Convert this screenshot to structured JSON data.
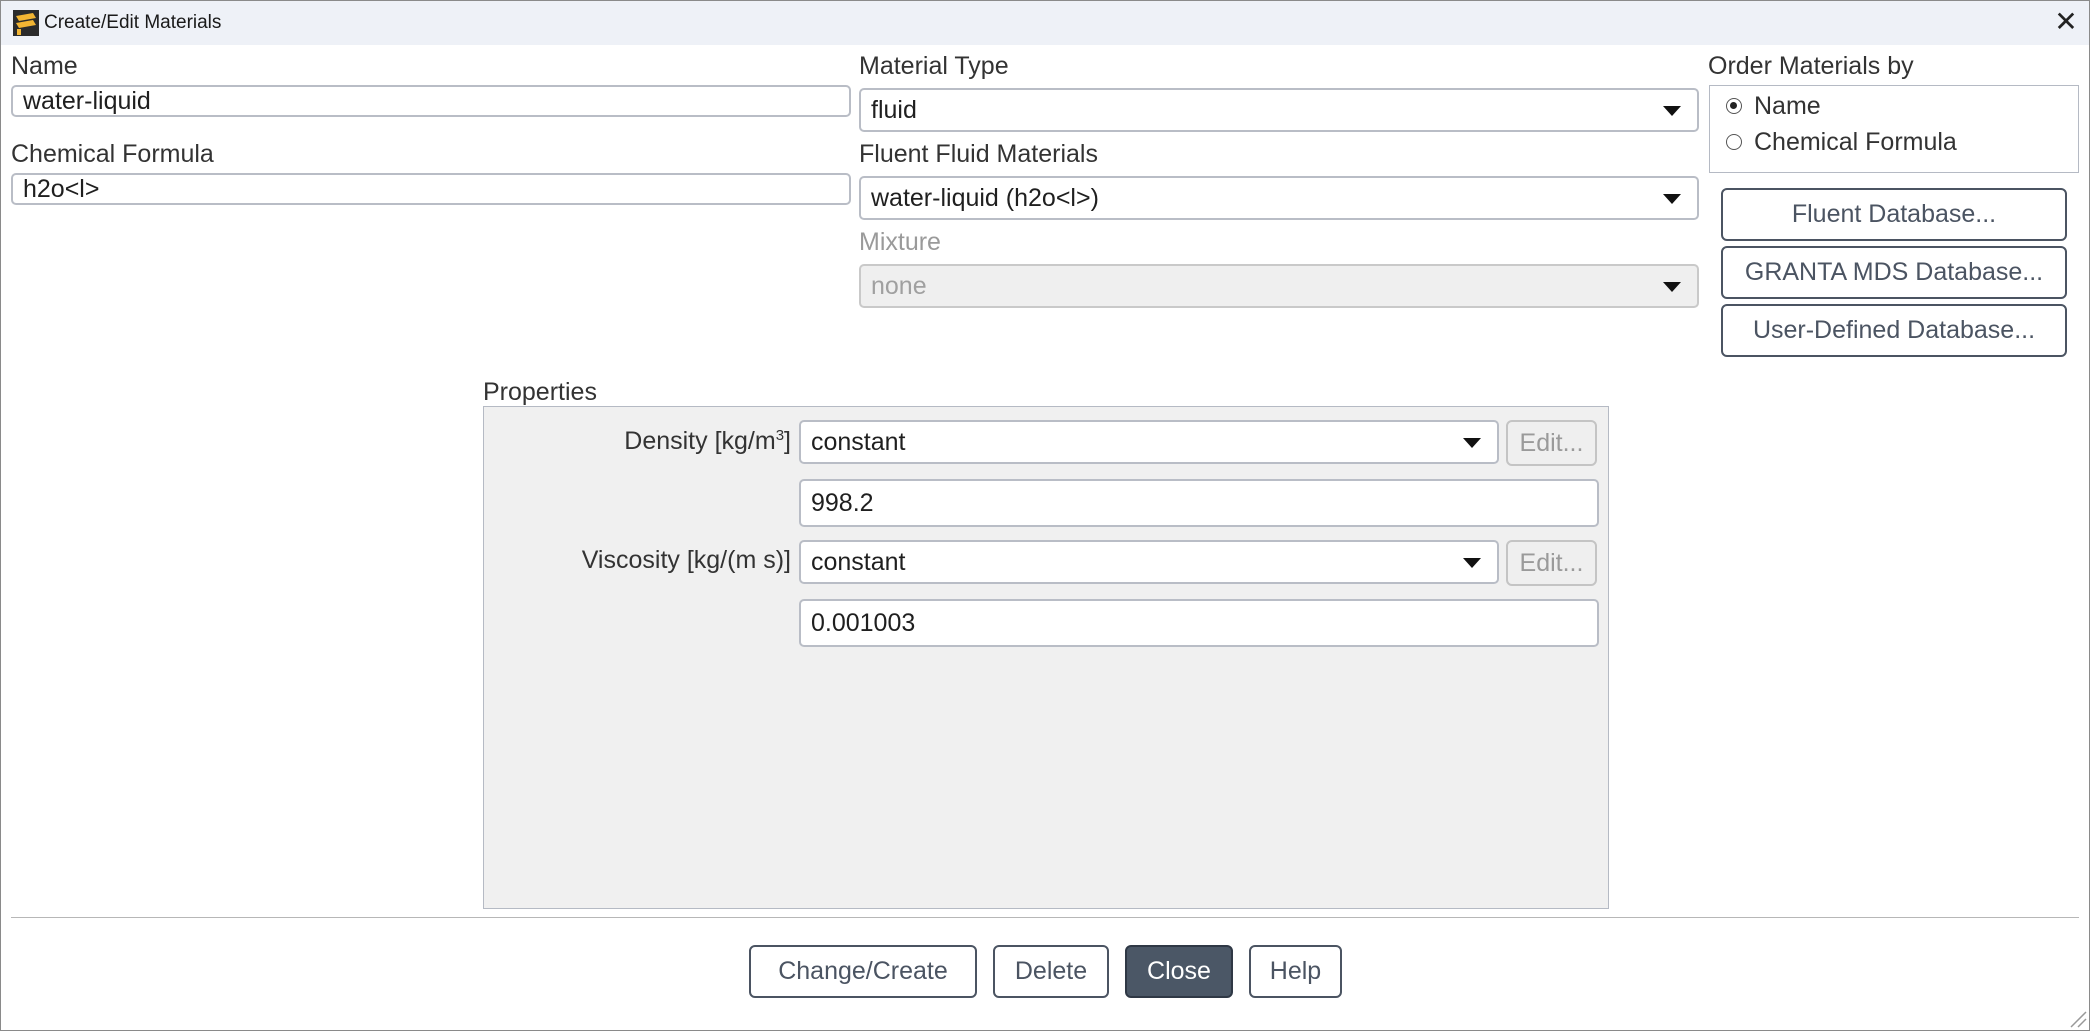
{
  "window": {
    "title": "Create/Edit Materials"
  },
  "name_section": {
    "label": "Name",
    "value": "water-liquid"
  },
  "formula_section": {
    "label": "Chemical Formula",
    "value": "h2o<l>"
  },
  "material_type": {
    "label": "Material Type",
    "value": "fluid"
  },
  "fluent_materials": {
    "label": "Fluent Fluid Materials",
    "value": "water-liquid (h2o<l>)"
  },
  "mixture": {
    "label": "Mixture",
    "value": "none"
  },
  "order_by": {
    "label": "Order Materials by",
    "options": [
      {
        "label": "Name",
        "selected": true
      },
      {
        "label": "Chemical Formula",
        "selected": false
      }
    ]
  },
  "database_buttons": {
    "fluent": "Fluent Database...",
    "granta": "GRANTA MDS Database...",
    "user_defined": "User-Defined Database..."
  },
  "properties": {
    "title": "Properties",
    "density": {
      "label": "Density [kg/m",
      "label_sup": "3",
      "label_end": "]",
      "method": "constant",
      "edit": "Edit...",
      "value": "998.2"
    },
    "viscosity": {
      "label": "Viscosity [kg/(m s)]",
      "method": "constant",
      "edit": "Edit...",
      "value": "0.001003"
    }
  },
  "footer": {
    "change_create": "Change/Create",
    "delete": "Delete",
    "close": "Close",
    "help": "Help"
  },
  "colors": {
    "titlebar": "#eef1f7",
    "button_border": "#4b5462",
    "primary_button": "#4b5766",
    "panel_bg": "#f0f0f0"
  },
  "icons": {
    "app": "fluent-app-icon",
    "close": "close-icon",
    "dropdown": "chevron-down-icon",
    "resize": "resize-grip-icon"
  }
}
